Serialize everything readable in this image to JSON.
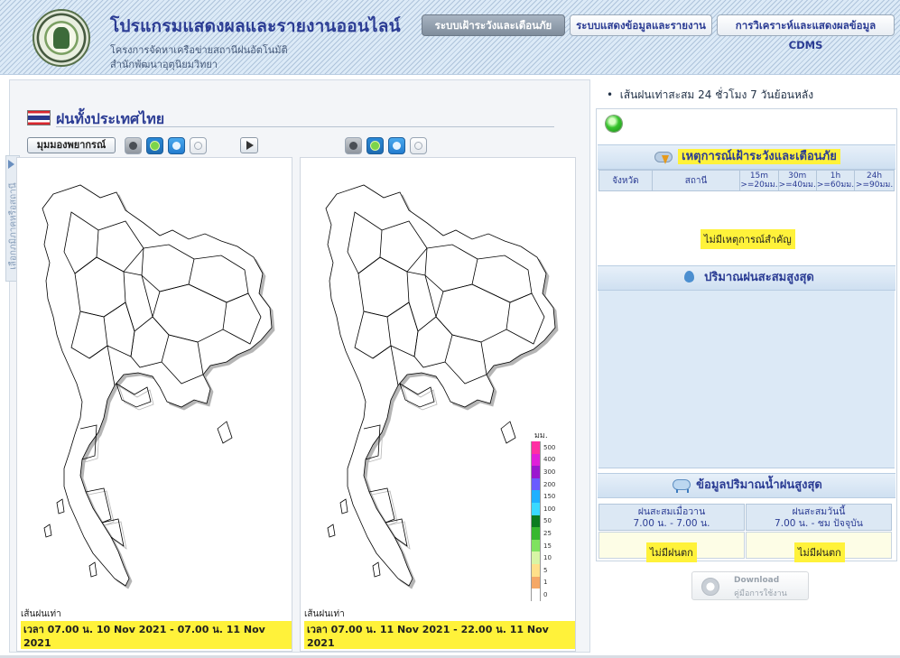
{
  "header": {
    "title": "โปรแกรมแสดงผลและรายงานออนไลน์",
    "subtitle_line1": "โครงการจัดหาเครือข่ายสถานีฝนอัตโนมัติ",
    "subtitle_line2": "สำนักพัฒนาอุตุนิยมวิทยา",
    "nav": [
      {
        "label": "ระบบเฝ้าระวังและเตือนภัย",
        "active": true
      },
      {
        "label": "ระบบแสดงข้อมูลและรายงาน",
        "active": false
      },
      {
        "label": "การวิเคราะห์และแสดงผลข้อมูล CDMS",
        "active": false
      }
    ]
  },
  "left": {
    "side_tab_label": "เลือกภูมิภาคหรือสถานี",
    "section_title": "ฝนทั้งประเทศไทย",
    "perspective_button": "มุมมองพยากรณ์",
    "maps": [
      {
        "caption_label": "เส้นฝนเท่า",
        "caption_time": "เวลา 07.00 น. 10 Nov 2021 - 07.00 น. 11 Nov 2021"
      },
      {
        "caption_label": "เส้นฝนเท่า",
        "caption_time": "เวลา 07.00 น. 11 Nov 2021 - 22.00 น. 11 Nov 2021"
      }
    ],
    "legend": {
      "unit": "มม.",
      "levels": [
        {
          "value": "500",
          "color": "#ff2fa3"
        },
        {
          "value": "400",
          "color": "#e01fd9"
        },
        {
          "value": "300",
          "color": "#9b17cf"
        },
        {
          "value": "200",
          "color": "#6a5cff"
        },
        {
          "value": "150",
          "color": "#1fb0ff"
        },
        {
          "value": "100",
          "color": "#3ad9ff"
        },
        {
          "value": "50",
          "color": "#0b7c1f"
        },
        {
          "value": "25",
          "color": "#37b82f"
        },
        {
          "value": "15",
          "color": "#7fe25f"
        },
        {
          "value": "10",
          "color": "#d8f5a5"
        },
        {
          "value": "5",
          "color": "#ffe08a"
        },
        {
          "value": "1",
          "color": "#f5a867"
        },
        {
          "value": "0",
          "color": "#ffffff"
        }
      ]
    }
  },
  "right": {
    "bullet_text": "เส้นฝนเท่าสะสม 24 ชั่วโมง 7 วันย้อนหลัง",
    "warning": {
      "header": "เหตุการณ์เฝ้าระวังและเตือนภัย",
      "columns": [
        "จังหวัด",
        "สถานี",
        "15m",
        "30m",
        "1h",
        "24h"
      ],
      "thresholds": [
        ">=20มม.",
        ">=40มม.",
        ">=60มม.",
        ">=90มม."
      ],
      "empty_text": "ไม่มีเหตุการณ์สำคัญ"
    },
    "max_rain": {
      "header": "ปริมาณฝนสะสมสูงสุด"
    },
    "max_water": {
      "header": "ข้อมูลปริมาณน้ำฝนสูงสุด",
      "col1_title": "ฝนสะสมเมื่อวาน",
      "col1_time": "7.00 น. - 7.00 น.",
      "col2_title": "ฝนสะสมวันนี้",
      "col2_time": "7.00 น. - ชม ปัจจุบัน",
      "no_rain": "ไม่มีฝนตก"
    },
    "download": {
      "line1": "Download",
      "line2": "คู่มือการใช้งาน"
    }
  }
}
